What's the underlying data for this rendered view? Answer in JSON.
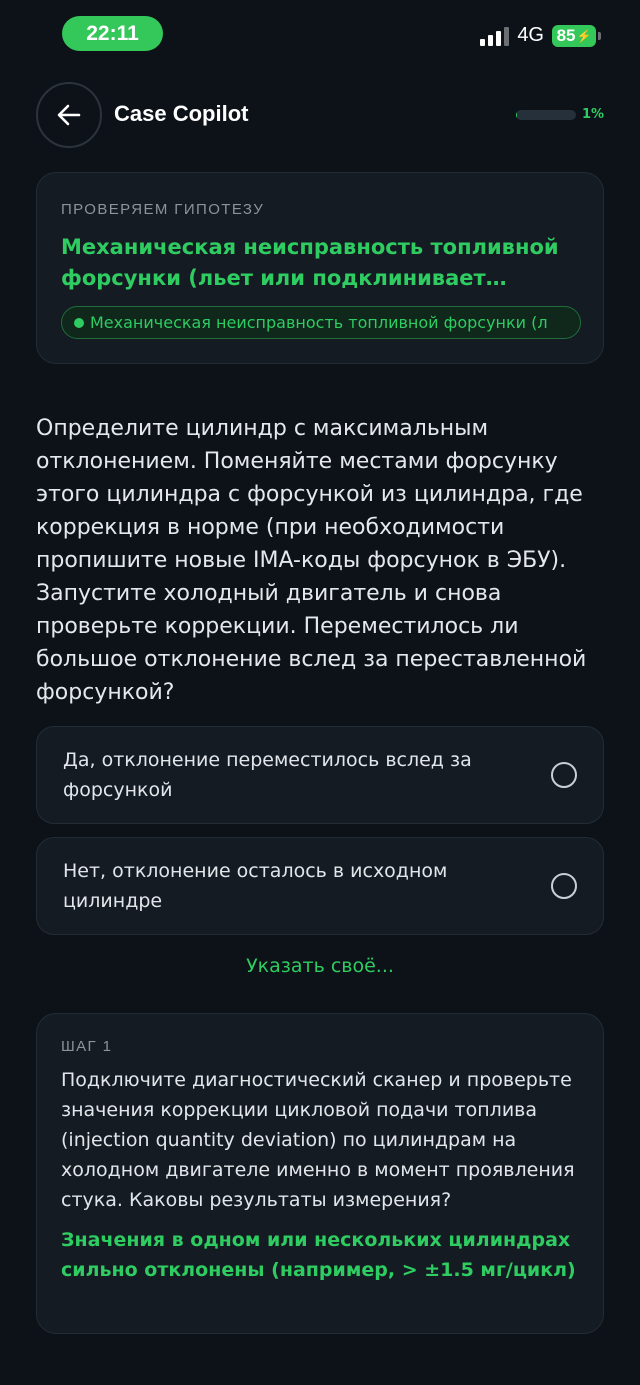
{
  "status_bar": {
    "time": "22:11",
    "network": "4G",
    "battery": "85"
  },
  "header": {
    "back_icon": "arrow-left-icon",
    "title": "Case Copilot",
    "progress_percent": 1,
    "progress_label": "1%"
  },
  "hypothesis": {
    "caption": "ПРОВЕРЯЕМ ГИПОТЕЗУ",
    "title": "Механическая неисправность топливной форсунки (льет или подклинивает распыл…",
    "chip_label": "Механическая неисправность топливной форсунки (л"
  },
  "question": "Определите цилиндр с максимальным отклонением. Поменяйте местами форсунку этого цилиндра с форсункой из цилиндра, где коррекция в норме (при необходимости пропишите новые IMA-коды форсунок в ЭБУ). Запустите холодный двигатель и снова проверьте коррекции. Переместилось ли большое отклонение вслед за переставленной форсункой?",
  "options": [
    {
      "label": "Да, отклонение переместилось вслед за форсункой",
      "selected": false
    },
    {
      "label": "Нет, отклонение осталось в исходном цилиндре",
      "selected": false
    }
  ],
  "custom_answer_link": "Указать своё...",
  "step": {
    "caption": "ШАГ 1",
    "text": "Подключите диагностический сканер и проверьте значения коррекции цикловой подачи топлива (injection quantity deviation) по цилиндрам на холодном двигателе именно в момент проявления стука. Каковы результаты измерения?",
    "answer": "Значения в одном или нескольких цилиндрах сильно отклонены (например, > ±1.5 мг/цикл)"
  },
  "colors": {
    "background": "#0d1218",
    "accent_green": "#2ecc61",
    "card_bg": "#141b22"
  }
}
